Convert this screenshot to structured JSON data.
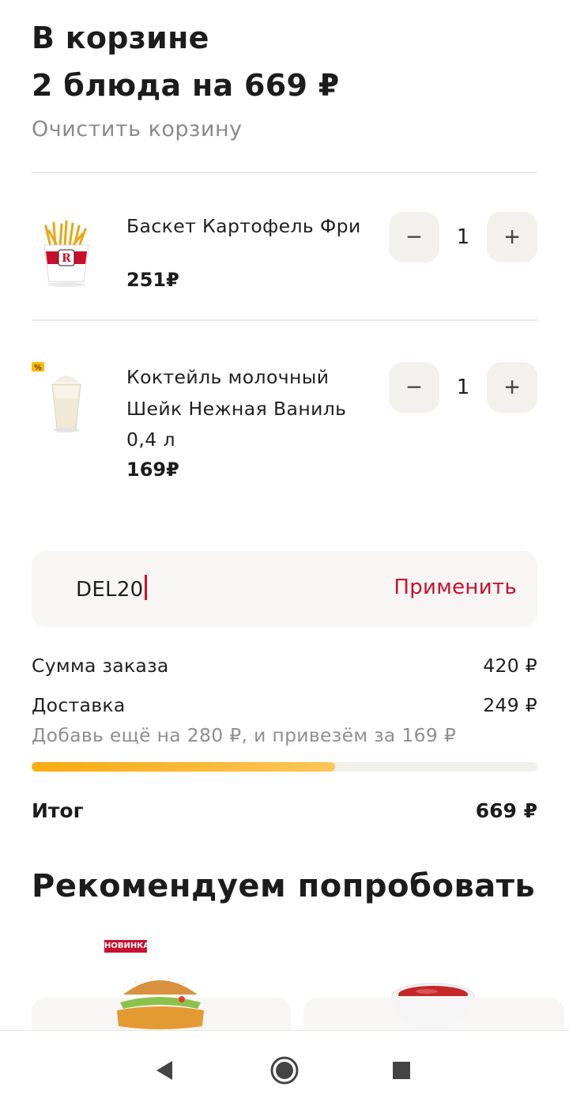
{
  "header": {
    "title": "В корзине",
    "summary": "2 блюда на 669 ₽",
    "clear_label": "Очистить корзину"
  },
  "cart": {
    "items": [
      {
        "name": "Баскет Картофель Фри",
        "price": "251₽",
        "quantity": "1",
        "image_icon": "fries-basket-icon"
      },
      {
        "name": "Коктейль молочный Шейк Нежная Ваниль",
        "volume": "0,4 л",
        "price": "169₽",
        "quantity": "1",
        "image_icon": "milkshake-icon",
        "badge_icon": "discount-percent-icon"
      }
    ],
    "minus_symbol": "−",
    "plus_symbol": "+"
  },
  "promo": {
    "value": "DEL20",
    "apply_label": "Применить"
  },
  "summary": {
    "order_sum_label": "Сумма заказа",
    "order_sum_value": "420 ₽",
    "delivery_label": "Доставка",
    "delivery_value": "249 ₽",
    "delivery_hint": "Добавь ещё на 280 ₽, и привезём за 169 ₽",
    "delivery_progress": 0.6,
    "total_label": "Итог",
    "total_value": "669 ₽"
  },
  "recommendations": {
    "title": "Рекомендуем попробовать",
    "items": [
      {
        "badge": "НОВИНКА",
        "image_icon": "chicken-burger-icon"
      },
      {
        "image_icon": "ketchup-sauce-icon"
      }
    ]
  },
  "colors": {
    "accent": "#c8102e",
    "progress": "#ffab10",
    "muted": "#8a8a8a",
    "card": "#f7f6f4"
  },
  "navbar": {
    "back_icon": "back-triangle-icon",
    "home_icon": "home-circle-icon",
    "recents_icon": "recents-square-icon"
  }
}
